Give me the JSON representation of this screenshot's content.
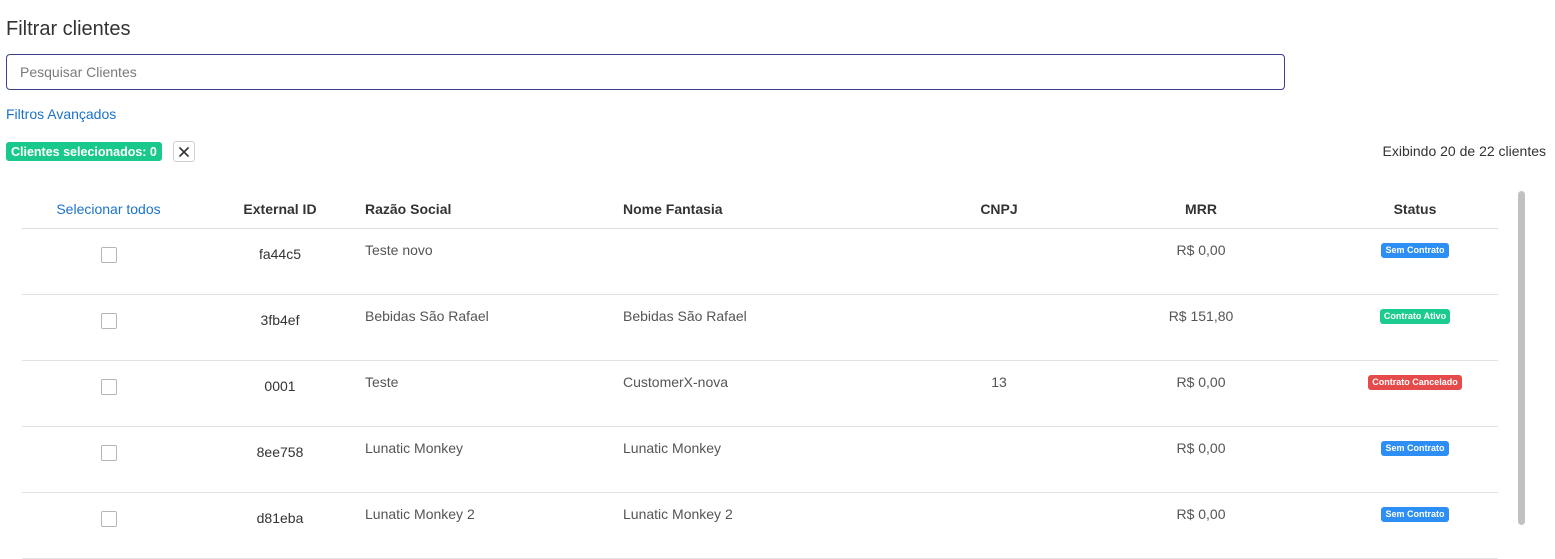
{
  "page": {
    "title": "Filtrar clientes"
  },
  "search": {
    "placeholder": "Pesquisar Clientes",
    "value": ""
  },
  "filters": {
    "advanced_label": "Filtros Avançados"
  },
  "selection": {
    "badge_label": "Clientes selecionados: 0",
    "clear_icon": "close-icon"
  },
  "counter": {
    "label": "Exibindo 20 de 22 clientes"
  },
  "table": {
    "headers": {
      "select_all": "Selecionar todos",
      "external_id": "External ID",
      "razao_social": "Razão Social",
      "nome_fantasia": "Nome Fantasia",
      "cnpj": "CNPJ",
      "mrr": "MRR",
      "status": "Status"
    },
    "rows": [
      {
        "external_id": "fa44c5",
        "razao_social": "Teste novo",
        "nome_fantasia": "",
        "cnpj": "",
        "mrr": "R$ 0,00",
        "status": "Sem Contrato",
        "status_color": "#2d8ef5",
        "checked": false
      },
      {
        "external_id": "3fb4ef",
        "razao_social": "Bebidas São Rafael",
        "nome_fantasia": "Bebidas São Rafael",
        "cnpj": "",
        "mrr": "R$ 151,80",
        "status": "Contrato Ativo",
        "status_color": "#1ccc8e",
        "checked": false
      },
      {
        "external_id": "0001",
        "razao_social": "Teste",
        "nome_fantasia": "CustomerX-nova",
        "cnpj": "13",
        "mrr": "R$ 0,00",
        "status": "Contrato Cancelado",
        "status_color": "#e54b4b",
        "checked": false
      },
      {
        "external_id": "8ee758",
        "razao_social": "Lunatic Monkey",
        "nome_fantasia": "Lunatic Monkey",
        "cnpj": "",
        "mrr": "R$ 0,00",
        "status": "Sem Contrato",
        "status_color": "#2d8ef5",
        "checked": false
      },
      {
        "external_id": "d81eba",
        "razao_social": "Lunatic Monkey 2",
        "nome_fantasia": "Lunatic Monkey 2",
        "cnpj": "",
        "mrr": "R$ 0,00",
        "status": "Sem Contrato",
        "status_color": "#2d8ef5",
        "checked": false
      }
    ]
  },
  "colors": {
    "accent_link": "#1a73c9",
    "selected_badge": "#19c98c",
    "status_sem_contrato": "#2d8ef5",
    "status_ativo": "#1ccc8e",
    "status_cancelado": "#e54b4b"
  }
}
